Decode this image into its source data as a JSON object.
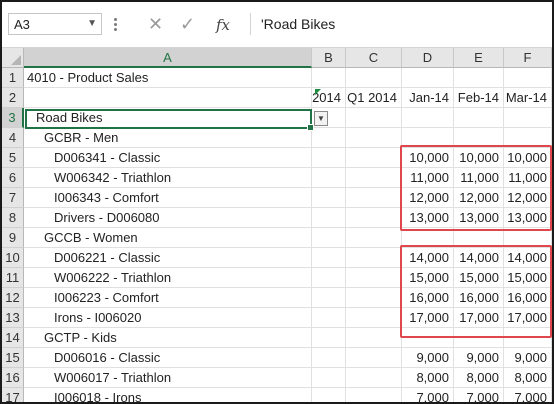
{
  "namebox": {
    "value": "A3",
    "dropdown_icon": "chevron-down-icon"
  },
  "formula_bar": {
    "icons": [
      "cancel-icon",
      "enter-icon",
      "fx-icon"
    ],
    "fx_label": "fx",
    "value": "'Road Bikes"
  },
  "columns": [
    "A",
    "B",
    "C",
    "D",
    "E",
    "F"
  ],
  "rows": [
    {
      "num": "1",
      "a": "4010 - Product Sales",
      "indent": 0,
      "b": "",
      "c": "",
      "d": "",
      "e": "",
      "f": ""
    },
    {
      "num": "2",
      "a": "",
      "indent": 0,
      "b": "2014",
      "c": "Q1 2014",
      "d": "Jan-14",
      "e": "Feb-14",
      "f": "Mar-14"
    },
    {
      "num": "3",
      "a": "Road Bikes",
      "indent": 1,
      "b": "",
      "c": "",
      "d": "",
      "e": "",
      "f": ""
    },
    {
      "num": "4",
      "a": "GCBR - Men",
      "indent": 2,
      "b": "",
      "c": "",
      "d": "",
      "e": "",
      "f": ""
    },
    {
      "num": "5",
      "a": "D006341 - Classic",
      "indent": 3,
      "b": "",
      "c": "",
      "d": "10,000",
      "e": "10,000",
      "f": "10,000"
    },
    {
      "num": "6",
      "a": "W006342 - Triathlon",
      "indent": 3,
      "b": "",
      "c": "",
      "d": "11,000",
      "e": "11,000",
      "f": "11,000"
    },
    {
      "num": "7",
      "a": "I006343 - Comfort",
      "indent": 3,
      "b": "",
      "c": "",
      "d": "12,000",
      "e": "12,000",
      "f": "12,000"
    },
    {
      "num": "8",
      "a": "Drivers - D006080",
      "indent": 3,
      "b": "",
      "c": "",
      "d": "13,000",
      "e": "13,000",
      "f": "13,000"
    },
    {
      "num": "9",
      "a": "GCCB - Women",
      "indent": 2,
      "b": "",
      "c": "",
      "d": "",
      "e": "",
      "f": ""
    },
    {
      "num": "10",
      "a": "D006221 - Classic",
      "indent": 3,
      "b": "",
      "c": "",
      "d": "14,000",
      "e": "14,000",
      "f": "14,000"
    },
    {
      "num": "11",
      "a": "W006222 - Triathlon",
      "indent": 3,
      "b": "",
      "c": "",
      "d": "15,000",
      "e": "15,000",
      "f": "15,000"
    },
    {
      "num": "12",
      "a": "I006223 - Comfort",
      "indent": 3,
      "b": "",
      "c": "",
      "d": "16,000",
      "e": "16,000",
      "f": "16,000"
    },
    {
      "num": "13",
      "a": "Irons - I006020",
      "indent": 3,
      "b": "",
      "c": "",
      "d": "17,000",
      "e": "17,000",
      "f": "17,000"
    },
    {
      "num": "14",
      "a": "GCTP - Kids",
      "indent": 2,
      "b": "",
      "c": "",
      "d": "",
      "e": "",
      "f": ""
    },
    {
      "num": "15",
      "a": "D006016 - Classic",
      "indent": 3,
      "b": "",
      "c": "",
      "d": "9,000",
      "e": "9,000",
      "f": "9,000"
    },
    {
      "num": "16",
      "a": "W006017 - Triathlon",
      "indent": 3,
      "b": "",
      "c": "",
      "d": "8,000",
      "e": "8,000",
      "f": "8,000"
    },
    {
      "num": "17",
      "a": "I006018 - Irons",
      "indent": 3,
      "b": "",
      "c": "",
      "d": "7,000",
      "e": "7,000",
      "f": "7,000"
    }
  ],
  "colors": {
    "selection": "#217346",
    "highlight_box": "#e0474c",
    "header_bg": "#e6e6e6"
  }
}
